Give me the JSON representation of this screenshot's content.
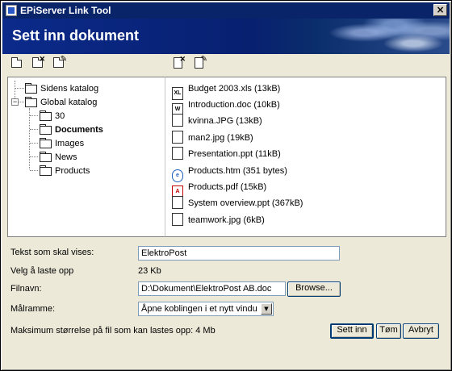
{
  "window": {
    "title": "EPiServer Link Tool",
    "close_glyph": "×"
  },
  "banner": {
    "title": "Sett inn dokument"
  },
  "toolbar_left": [
    {
      "icon": "folder-open-icon"
    },
    {
      "icon": "folder-delete-icon"
    },
    {
      "icon": "folder-edit-icon"
    }
  ],
  "toolbar_right": [
    {
      "icon": "file-delete-icon"
    },
    {
      "icon": "file-edit-icon"
    }
  ],
  "tree": [
    {
      "label": "Sidens katalog",
      "level": 0,
      "expander": ""
    },
    {
      "label": "Global katalog",
      "level": 0,
      "expander": "−"
    },
    {
      "label": "30",
      "level": 1,
      "expander": ""
    },
    {
      "label": "Documents",
      "level": 1,
      "expander": "",
      "selected": true
    },
    {
      "label": "Images",
      "level": 1,
      "expander": ""
    },
    {
      "label": "News",
      "level": 1,
      "expander": ""
    },
    {
      "label": "Products",
      "level": 1,
      "expander": ""
    }
  ],
  "files": [
    {
      "name": "Budget 2003.xls (13kB)",
      "type": "xls",
      "glyph": "XL"
    },
    {
      "name": "Introduction.doc (10kB)",
      "type": "doc",
      "glyph": "W"
    },
    {
      "name": "kvinna.JPG (13kB)",
      "type": "jpg",
      "glyph": ""
    },
    {
      "name": "man2.jpg (19kB)",
      "type": "jpg",
      "glyph": ""
    },
    {
      "name": "Presentation.ppt (11kB)",
      "type": "ppt",
      "glyph": ""
    },
    {
      "name": "Products.htm (351 bytes)",
      "type": "htm",
      "glyph": "e"
    },
    {
      "name": "Products.pdf (15kB)",
      "type": "pdf",
      "glyph": "A"
    },
    {
      "name": "System overview.ppt (367kB)",
      "type": "ppt",
      "glyph": ""
    },
    {
      "name": "teamwork.jpg (6kB)",
      "type": "jpg",
      "glyph": ""
    }
  ],
  "form": {
    "display_text_label": "Tekst som skal vises:",
    "display_text_value": "ElektroPost",
    "upload_label": "Velg å laste opp",
    "upload_value": "23 Kb",
    "filename_label": "Filnavn:",
    "filename_value": "D:\\Dokument\\ElektroPost AB.doc",
    "browse_label": "Browse...",
    "target_label": "Målramme:",
    "target_value": "Åpne koblingen i et nytt vindu",
    "max_size_text": "Maksimum størrelse på fil som kan lastes opp:  4 Mb",
    "insert_label": "Sett inn",
    "clear_label": "Tøm",
    "cancel_label": "Avbryt"
  }
}
